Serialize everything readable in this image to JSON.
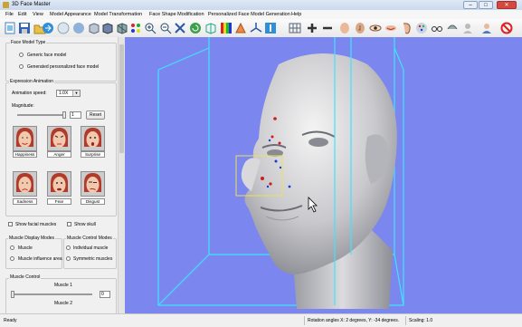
{
  "window": {
    "title": "3D Face Master",
    "minimize": "–",
    "maximize": "□",
    "close": "✕"
  },
  "menu": [
    "File",
    "Edit",
    "View",
    "Model Appearance",
    "Model Transformation",
    "Face Shape Modification",
    "Personalized Face Model Generation",
    "Help"
  ],
  "panel": {
    "face_model_type": {
      "title": "Face Model Type",
      "options": [
        "Generic face model",
        "Generated personalized face model"
      ]
    },
    "expression_animation": {
      "title": "Expression Animation",
      "speed_label": "Animation speed:",
      "speed_value": "1.0X",
      "magnitude_label": "Magnitude:",
      "magnitude_value": "1",
      "reset_label": "Reset",
      "expressions": [
        "Happiness",
        "Anger",
        "Surprise",
        "Sadness",
        "Fear",
        "Disgust"
      ]
    },
    "show_facial_muscles": "Show facial muscles",
    "show_skull": "Show skull",
    "muscle_display_modes": {
      "title": "Muscle Display Modes",
      "options": [
        "Muscle",
        "Muscle influence area"
      ]
    },
    "muscle_control_modes": {
      "title": "Muscle Control Modes",
      "options": [
        "Individual muscle",
        "Symmetric muscles"
      ]
    },
    "muscle_control": {
      "title": "Muscle Control",
      "muscle1_label": "Muscle 1",
      "muscle1_value": "0",
      "muscle2_label": "Muscle 2"
    }
  },
  "status": {
    "ready": "Ready",
    "rotation": "Rotation angles X: 2 degrees, Y: -34 degrees.",
    "scaling": "Scaling: 1.0"
  },
  "colors": {
    "viewport_bg": "#7b86ee",
    "bounding_box": "#3fe3ff",
    "selection_box": "#e8e05a",
    "landmark_red": "#d21a1a",
    "landmark_blue": "#1a3ad2"
  },
  "icons": [
    "new-icon",
    "save-icon",
    "open-icon",
    "export-icon",
    "cube-icon",
    "sphere-icon",
    "cube-flat-icon",
    "cube-shaded-icon",
    "grid-icon",
    "zoom-in-icon",
    "zoom-out-icon",
    "fit-icon",
    "rotate-icon",
    "box-icon",
    "color-spectrum-icon",
    "vertex-icon",
    "axes-icon",
    "landmark-icon",
    "mesh-icon",
    "add-icon",
    "remove-icon",
    "head-icon",
    "nose-icon",
    "eye-icon",
    "mouth-icon",
    "ear-icon",
    "palette-icon",
    "glasses-icon",
    "hair-icon",
    "forbid-icon"
  ]
}
